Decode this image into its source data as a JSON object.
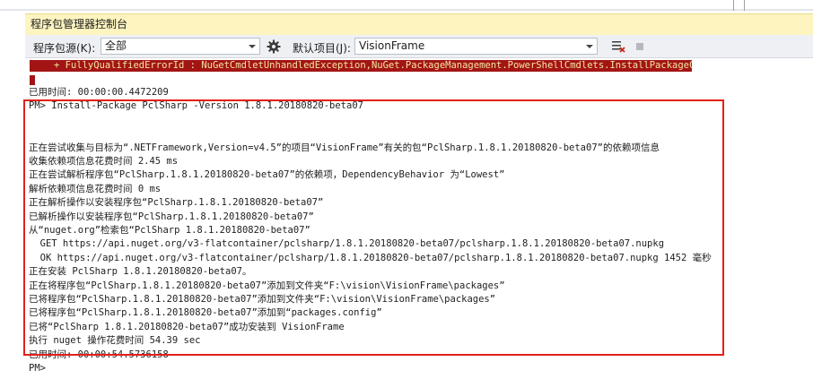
{
  "window": {
    "title": "程序包管理器控制台"
  },
  "toolbar": {
    "source_label": "程序包源(K):",
    "source_value": "全部",
    "gear_icon": "gear-icon",
    "default_project_label": "默认项目(J):",
    "default_project_value": "VisionFrame",
    "clear_icon": "clear-console-icon",
    "stop_icon": "stop-icon"
  },
  "console": {
    "error_line": "   + FullyQualifiedErrorId : NuGetCmdletUnhandledException,NuGet.PackageManagement.PowerShellCmdlets.InstallPackageCommand",
    "lines": [
      "已用时间: 00:00:00.4472209",
      "PM> Install-Package PclSharp -Version 1.8.1.20180820-beta07",
      "",
      "",
      "正在尝试收集与目标为“.NETFramework,Version=v4.5”的项目“VisionFrame”有关的包“PclSharp.1.8.1.20180820-beta07”的依赖项信息",
      "收集依赖项信息花费时间 2.45 ms",
      "正在尝试解析程序包“PclSharp.1.8.1.20180820-beta07”的依赖项，DependencyBehavior 为“Lowest”",
      "解析依赖项信息花费时间 0 ms",
      "正在解析操作以安装程序包“PclSharp.1.8.1.20180820-beta07”",
      "已解析操作以安装程序包“PclSharp.1.8.1.20180820-beta07”",
      "从“nuget.org”检索包“PclSharp 1.8.1.20180820-beta07”",
      "  GET https://api.nuget.org/v3-flatcontainer/pclsharp/1.8.1.20180820-beta07/pclsharp.1.8.1.20180820-beta07.nupkg",
      "  OK https://api.nuget.org/v3-flatcontainer/pclsharp/1.8.1.20180820-beta07/pclsharp.1.8.1.20180820-beta07.nupkg 1452 毫秒",
      "正在安装 PclSharp 1.8.1.20180820-beta07。",
      "正在将程序包“PclSharp.1.8.1.20180820-beta07”添加到文件夹“F:\\vision\\VisionFrame\\packages”",
      "已将程序包“PclSharp.1.8.1.20180820-beta07”添加到文件夹“F:\\vision\\VisionFrame\\packages”",
      "已将程序包“PclSharp.1.8.1.20180820-beta07”添加到“packages.config”",
      "已将“PclSharp 1.8.1.20180820-beta07”成功安装到 VisionFrame",
      "执行 nuget 操作花费时间 54.39 sec",
      "已用时间: 00:00:54.5736158",
      "PM>"
    ]
  }
}
